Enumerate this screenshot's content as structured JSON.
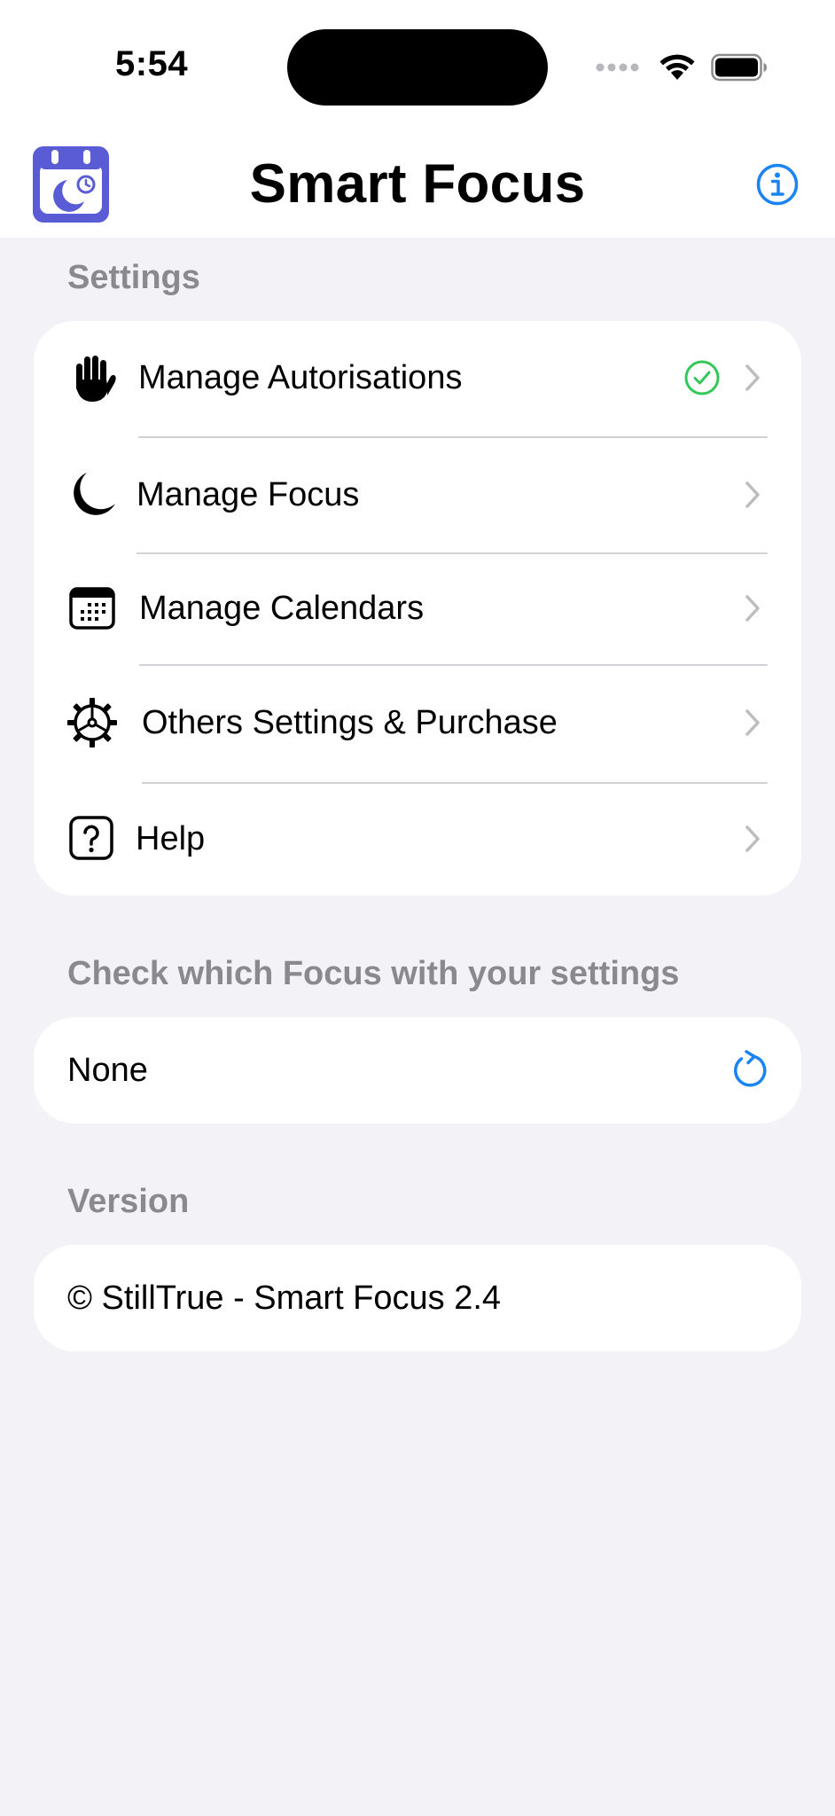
{
  "status_bar": {
    "time": "5:54"
  },
  "header": {
    "title": "Smart Focus",
    "app_icon": "calendar-moon-app-icon",
    "info_icon": "info-circle-icon",
    "accent_color": "#1a84f2"
  },
  "settings_section": {
    "header": "Settings",
    "items": [
      {
        "label": "Manage Autorisations",
        "icon": "hand-raised-icon",
        "status_icon": "checkmark-circle-icon",
        "status_color": "#34c759"
      },
      {
        "label": "Manage Focus",
        "icon": "moon-icon"
      },
      {
        "label": "Manage Calendars",
        "icon": "calendar-icon"
      },
      {
        "label": "Others Settings & Purchase",
        "icon": "gear-icon"
      },
      {
        "label": "Help",
        "icon": "question-square-icon"
      }
    ]
  },
  "focus_section": {
    "header": "Check which Focus with your settings",
    "value": "None",
    "refresh_icon": "refresh-icon"
  },
  "version_section": {
    "header": "Version",
    "text": "© StillTrue - Smart Focus 2.4"
  }
}
